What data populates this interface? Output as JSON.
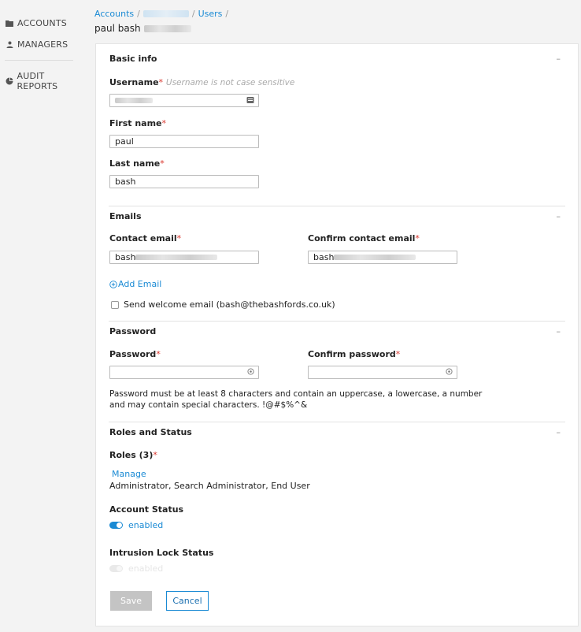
{
  "sidebar": {
    "items": [
      {
        "label": "ACCOUNTS",
        "icon": "folder-icon"
      },
      {
        "label": "MANAGERS",
        "icon": "person-icon"
      },
      {
        "label": "AUDIT REPORTS",
        "icon": "pie-chart-icon"
      }
    ]
  },
  "breadcrumb": {
    "accounts": "Accounts",
    "separator": "/",
    "users": "Users"
  },
  "page_title": "paul bash",
  "basic_info": {
    "title": "Basic info",
    "collapse": "–",
    "username_label": "Username",
    "username_hint": "Username is not case sensitive",
    "first_name_label": "First name",
    "first_name_value": "paul",
    "last_name_label": "Last name",
    "last_name_value": "bash"
  },
  "emails": {
    "title": "Emails",
    "collapse": "–",
    "contact_label": "Contact email",
    "contact_value": "bash",
    "confirm_label": "Confirm contact email",
    "confirm_value": "bash",
    "add_email": "Add Email",
    "welcome_label": "Send welcome email (bash@thebashfords.co.uk)"
  },
  "password": {
    "title": "Password",
    "collapse": "–",
    "password_label": "Password",
    "confirm_label": "Confirm password",
    "help_line1": "Password must be at least 8 characters and contain an uppercase, a lowercase, a number",
    "help_line2": "and may contain special characters. !@#$%^&"
  },
  "roles": {
    "title": "Roles and Status",
    "collapse": "–",
    "roles_label": "Roles (3)",
    "manage": "Manage",
    "roles_value": "Administrator, Search Administrator, End User",
    "account_status_label": "Account Status",
    "account_status_value": "enabled",
    "intrusion_label": "Intrusion Lock Status",
    "intrusion_value": "enabled"
  },
  "actions": {
    "save": "Save",
    "cancel": "Cancel"
  },
  "required_mark": "*",
  "colors": {
    "accent": "#1a8ad4",
    "required": "#d9342b",
    "disabled_button": "#c4c4c4"
  }
}
